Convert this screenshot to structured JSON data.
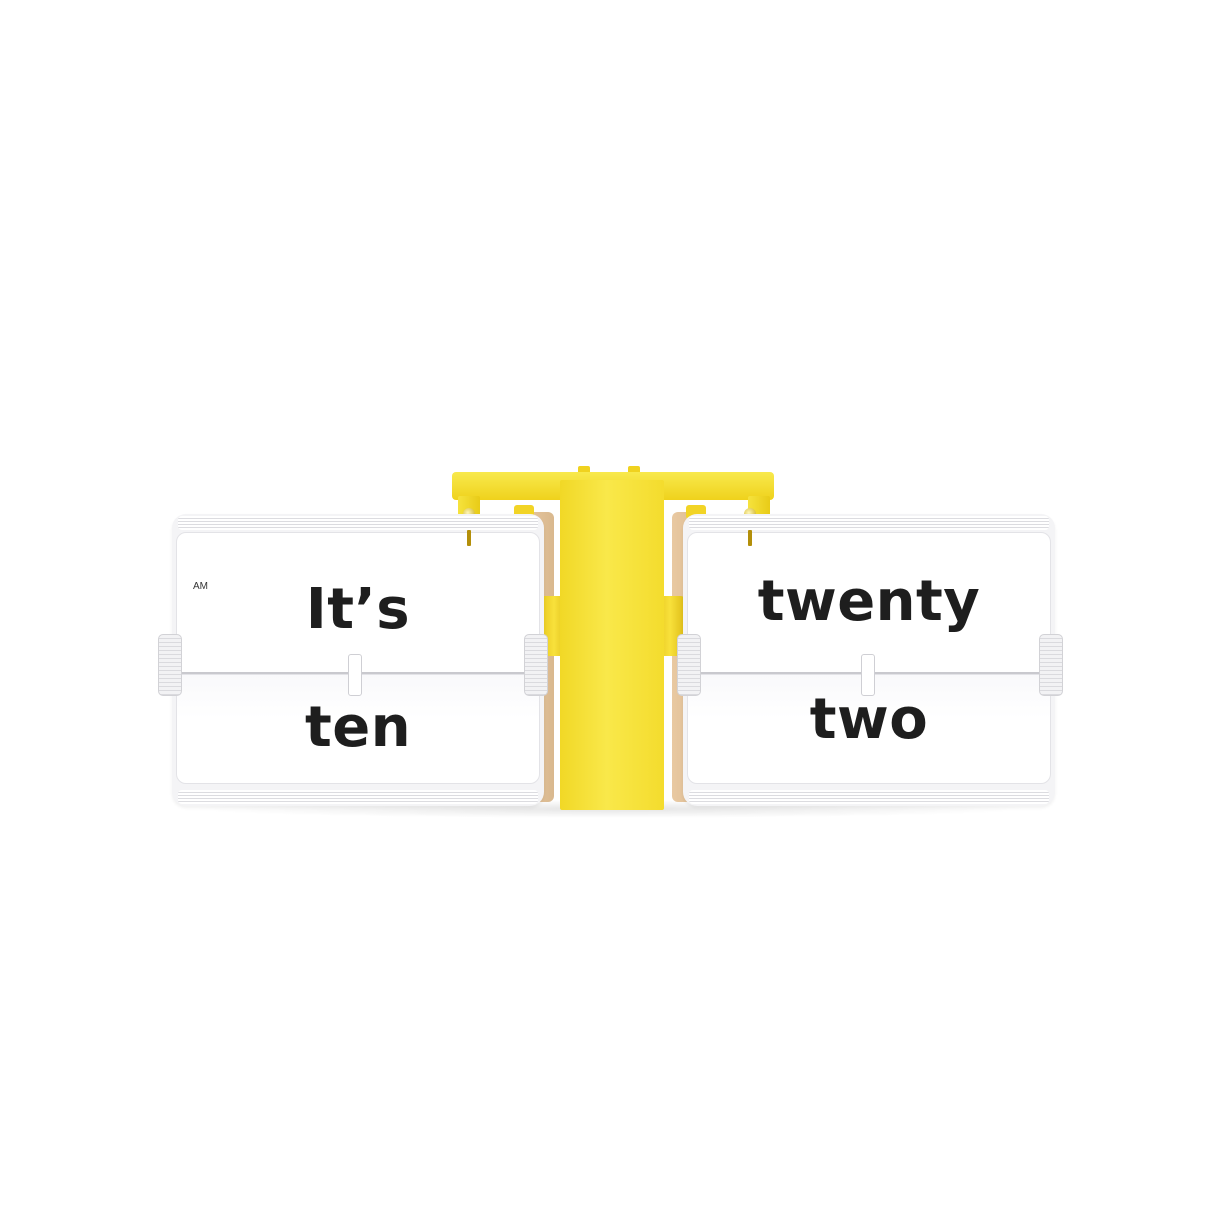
{
  "clock": {
    "left_panel": {
      "period": "AM",
      "top_word": "It’s",
      "bottom_word": "ten"
    },
    "right_panel": {
      "top_word": "twenty",
      "bottom_word": "two"
    }
  },
  "colors": {
    "background": "#ffffff",
    "frame": "#f3dc2c",
    "card": "#ffffff",
    "text": "#1e1e1e"
  }
}
